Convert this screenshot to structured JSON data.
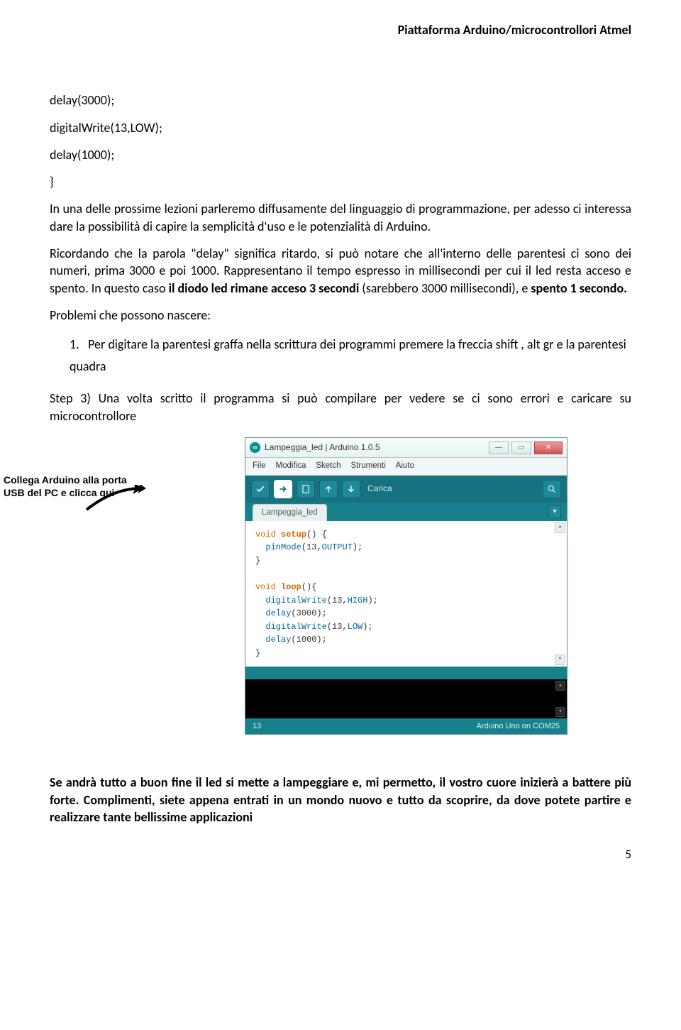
{
  "header": "Piattaforma Arduino/microcontrollori Atmel",
  "code": {
    "l1": "delay(3000);",
    "l2": "digitalWrite(13,LOW);",
    "l3": "delay(1000);",
    "l4": "}"
  },
  "para1_a": "In una delle prossime lezioni parleremo diffusamente del linguaggio di programmazione, per adesso ci interessa dare la possibilità di capire la semplicità d'uso e le potenzialità di Arduino.",
  "para2_a": "Ricordando che la parola \"delay\" significa ritardo, si può notare che all'interno delle parentesi ci sono dei numeri, prima 3000 e poi 1000. Rappresentano il tempo espresso in millisecondi per cui il led resta acceso e spento. In questo caso ",
  "para2_b": "il diodo led rimane acceso 3 secondi",
  "para2_c": " (sarebbero 3000 millisecondi), e ",
  "para2_d": "spento 1 secondo.",
  "probl_title": "Problemi che possono nascere:",
  "list1_num": "1.",
  "list1_text": "Per digitare la parentesi graffa nella scrittura dei programmi premere la freccia shift , alt gr e la parentesi quadra",
  "step3": "Step 3) Una volta scritto il programma si può compilare per vedere se ci sono errori e caricare su microcontrollore",
  "annotation_l1": "Collega Arduino alla porta",
  "annotation_l2": "USB del PC e clicca qui",
  "ide": {
    "title": "Lampeggia_led | Arduino 1.0.5",
    "menu": {
      "file": "File",
      "edit": "Modifica",
      "sketch": "Sketch",
      "tools": "Strumenti",
      "help": "Aiuto"
    },
    "upload_label": "Carica",
    "tab_name": "Lampeggia_led",
    "status_left": "13",
    "status_right": "Arduino Uno on COM25",
    "sketch_code": {
      "setup_sig_a": "void",
      "setup_sig_b": "setup",
      "setup_sig_c": "() {",
      "pinmode_a": "pinMode",
      "pinmode_b": "(13,",
      "pinmode_c": "OUTPUT",
      "pinmode_d": ");",
      "brace": "}",
      "loop_sig_a": "void",
      "loop_sig_b": "loop",
      "loop_sig_c": "(){",
      "dw1_a": "digitalWrite",
      "dw1_b": "(13,",
      "dw1_c": "HIGH",
      "dw1_d": ");",
      "d1_a": "delay",
      "d1_b": "(3000);",
      "dw2_a": "digitalWrite",
      "dw2_b": "(13,",
      "dw2_c": "LOW",
      "dw2_d": ");",
      "d2_a": "delay",
      "d2_b": "(1000);"
    }
  },
  "closing_a": "Se andrà tutto a buon fine il led si mette a lampeggiare e, mi permetto, il vostro cuore inizierà a battere più forte. Complimenti, siete appena entrati in un mondo nuovo e tutto da scoprire, da dove potete partire e realizzare tante bellissime applicazioni",
  "page_num": "5"
}
